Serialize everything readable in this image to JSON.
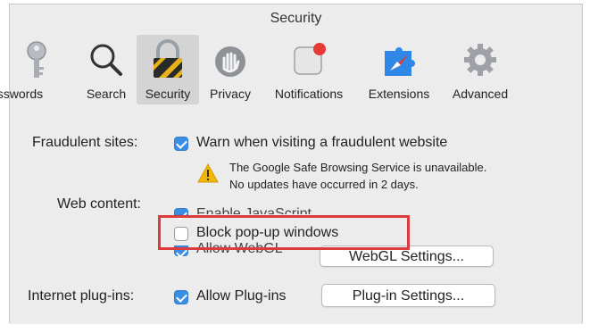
{
  "window": {
    "title": "Security"
  },
  "toolbar": {
    "items": [
      {
        "label": "asswords",
        "icon": "key-icon"
      },
      {
        "label": "Search",
        "icon": "magnifier-icon"
      },
      {
        "label": "Security",
        "icon": "padlock-icon",
        "selected": true
      },
      {
        "label": "Privacy",
        "icon": "hand-icon"
      },
      {
        "label": "Notifications",
        "icon": "notification-icon"
      },
      {
        "label": "Extensions",
        "icon": "puzzle-compass-icon"
      },
      {
        "label": "Advanced",
        "icon": "gear-icon"
      }
    ]
  },
  "fraudulent": {
    "label": "Fraudulent sites:",
    "option": "Warn when visiting a fraudulent website",
    "checked": true,
    "warning_line1": "The Google Safe Browsing Service is unavailable.",
    "warning_line2": "No updates have occurred in 2 days."
  },
  "web_content": {
    "label": "Web content:",
    "hidden_option": "Enable JavaScript",
    "popup_option": "Block pop-up windows",
    "popup_checked": false,
    "webgl_option": "Allow WebGL",
    "webgl_checked": true,
    "webgl_button": "WebGL Settings..."
  },
  "plugins": {
    "label": "Internet plug-ins:",
    "option": "Allow Plug-ins",
    "checked": true,
    "button": "Plug-in Settings..."
  },
  "colors": {
    "accent": "#3a8ee6",
    "highlight": "#dd3b3b",
    "warning": "#f2b705"
  }
}
